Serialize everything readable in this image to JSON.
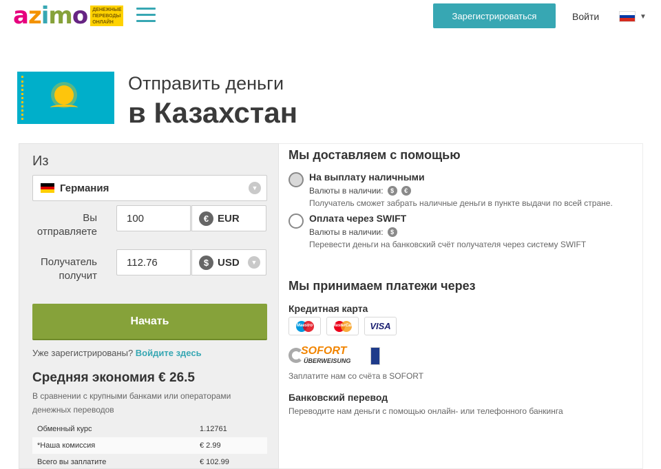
{
  "header": {
    "logo_text": "azimo",
    "logo_tagline": "денежные переводы онлайн",
    "register_label": "Зарегистрироваться",
    "login_label": "Войти",
    "language_caret": "▼"
  },
  "hero": {
    "title_line1": "Отправить деньги",
    "title_line2": "в Казахстан"
  },
  "form": {
    "from_label": "Из",
    "country": "Германия",
    "send_label": "Вы отправляете",
    "send_amount": "100",
    "send_currency": "EUR",
    "send_currency_symbol": "€",
    "receive_label": "Получатель получит",
    "receive_amount": "112.76",
    "receive_currency": "USD",
    "receive_currency_symbol": "$",
    "select_caret": "▼",
    "start_button": "Начать",
    "registered_text": "Уже зарегистрированы?",
    "login_here": "Войдите здесь",
    "savings_title": "Средняя экономия € 26.5",
    "savings_desc": "В сравнении с крупными банками или операторами денежных переводов",
    "fees": [
      {
        "label": "Обменный курс",
        "value": "1.12761"
      },
      {
        "label": "*Наша комиссия",
        "value": "€ 2.99"
      },
      {
        "label": "Всего вы заплатите",
        "value": "€ 102.99"
      }
    ]
  },
  "delivery": {
    "title": "Мы доставляем с помощью",
    "methods": [
      {
        "icon": "coins-icon",
        "title": "На выплату наличными",
        "currencies_label": "Валюты в наличии:",
        "currencies": [
          "$",
          "€"
        ],
        "description": "Получатель сможет забрать наличные деньги в пункте выдачи по всей стране."
      },
      {
        "icon": "globe-icon",
        "title": "Оплата через SWIFT",
        "currencies_label": "Валюты в наличии:",
        "currencies": [
          "$"
        ],
        "description": "Перевести деньги на банковский счёт получателя через систему SWIFT"
      }
    ]
  },
  "payments": {
    "title": "Мы принимаем платежи через",
    "credit_card_title": "Кредитная карта",
    "cards": [
      "Maestro",
      "MasterCard",
      "VISA"
    ],
    "sofort_line1": "SOFORT",
    "sofort_line2": "ÜBERWEISUNG",
    "sofort_desc": "Заплатите нам со счёта в SOFORT",
    "bank_title": "Банковский перевод",
    "bank_desc": "Переводите нам деньги с помощью онлайн- или телефонного банкинга"
  },
  "colors": {
    "accent": "#37a7b3",
    "start_button": "#86a23a",
    "kz_flag": "#00afca",
    "kz_sun": "#fec50c"
  }
}
